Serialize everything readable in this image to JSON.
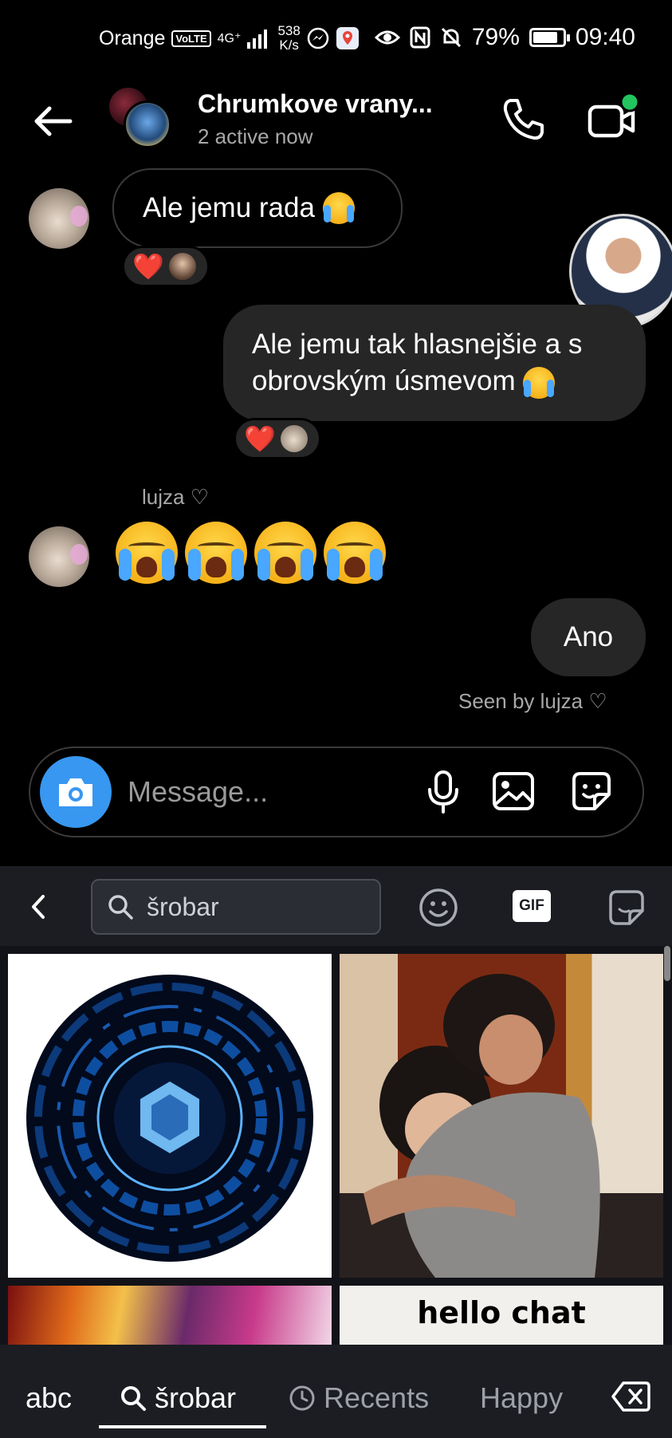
{
  "status_bar": {
    "carrier": "Orange",
    "volte": "VoLTE",
    "network": "4G⁺",
    "speed_value": "538",
    "speed_unit": "K/s",
    "battery": "79%",
    "time": "09:40"
  },
  "header": {
    "title": "Chrumkove vrany...",
    "subtitle": "2 active now"
  },
  "messages": [
    {
      "text": "Ale jemu rada",
      "emoji": "loudly-crying-face",
      "direction": "incoming",
      "reaction": "❤️"
    },
    {
      "text_line1": "Ale jemu tak hlasnejšie a s",
      "text_line2": "obrovským úsmevom",
      "emoji": "loudly-crying-face",
      "direction": "outgoing",
      "reaction": "❤️"
    },
    {
      "sender": "lujza ♡",
      "emoji_count": 4,
      "emoji": "loudly-crying-face",
      "direction": "incoming"
    },
    {
      "text": "Ano",
      "direction": "outgoing"
    }
  ],
  "seen": "Seen by lujza ♡",
  "composer": {
    "placeholder": "Message..."
  },
  "gif_panel": {
    "search_value": "šrobar",
    "gif_label": "GIF",
    "tiles": [
      {
        "name": "blue-tech-circle"
      },
      {
        "name": "hugging-couple"
      },
      {
        "name": "colorful-blur"
      },
      {
        "name": "hello-chat",
        "caption": "hello chat"
      }
    ]
  },
  "keyboard_tabs": {
    "abc": "abc",
    "search": "šrobar",
    "recents": "Recents",
    "happy": "Happy"
  },
  "colors": {
    "accent": "#3897f0",
    "bubble_out": "#262626",
    "heart": "#ff2e3a",
    "online": "#22c55e"
  }
}
